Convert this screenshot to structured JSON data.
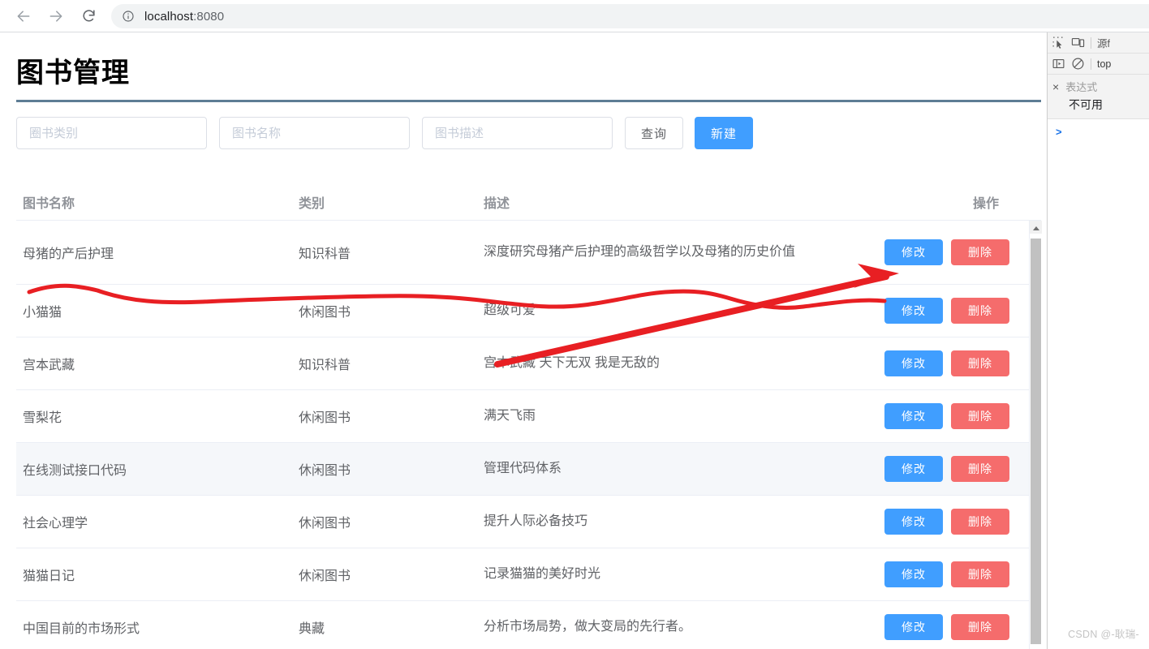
{
  "browser": {
    "back_label": "back-arrow",
    "forward_label": "forward-arrow",
    "reload_label": "reload",
    "info_label": "site-info",
    "url_host": "localhost",
    "url_port": ":8080"
  },
  "page": {
    "title": "图书管理"
  },
  "toolbar": {
    "category_placeholder": "圈书类别",
    "category_value": "",
    "name_placeholder": "图书名称",
    "name_value": "",
    "desc_placeholder": "图书描述",
    "desc_value": "",
    "query_label": "查询",
    "create_label": "新建"
  },
  "table": {
    "headers": {
      "name": "图书名称",
      "category": "类别",
      "description": "描述",
      "operations": "操作"
    },
    "edit_label": "修改",
    "delete_label": "删除",
    "rows": [
      {
        "name": "母猪的产后护理",
        "category": "知识科普",
        "description": "深度研究母猪产后护理的高级哲学以及母猪的历史价值"
      },
      {
        "name": "小猫猫",
        "category": "休闲图书",
        "description": "超级可爱"
      },
      {
        "name": "宫本武藏",
        "category": "知识科普",
        "description": "宫本武藏 天下无双 我是无敌的"
      },
      {
        "name": "雪梨花",
        "category": "休闲图书",
        "description": "满天飞雨"
      },
      {
        "name": "在线测试接口代码",
        "category": "休闲图书",
        "description": "管理代码体系"
      },
      {
        "name": "社会心理学",
        "category": "休闲图书",
        "description": "提升人际必备技巧"
      },
      {
        "name": "猫猫日记",
        "category": "休闲图书",
        "description": "记录猫猫的美好时光"
      },
      {
        "name": "中国目前的市场形式",
        "category": "典藏",
        "description": "分析市场局势，做大变局的先行者。"
      }
    ]
  },
  "devtools": {
    "inspect_icon": "inspect-element-icon",
    "device_icon": "device-toolbar-icon",
    "sources_tab": "源f",
    "sidebar_icon": "show-navigator-icon",
    "clear_icon": "no-entry-icon",
    "context_selector": "top",
    "watch_close": "×",
    "watch_title": "表达式",
    "watch_value": "不可用",
    "console_prompt": ">"
  },
  "watermark": "CSDN @-耿瑞-",
  "colors": {
    "primary_blue": "#409eff",
    "danger_red": "#f56c6c",
    "divider_slate": "#5d7d94",
    "annotation_red": "#e81f23"
  }
}
